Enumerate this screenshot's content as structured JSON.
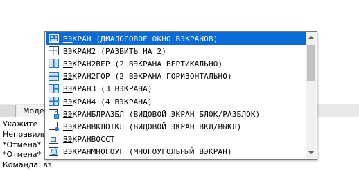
{
  "autocomplete": {
    "typed_prefix": "ВЭ",
    "items": [
      {
        "prefix": "ВЭ",
        "rest": "КРАН (ДИАЛОГОВОЕ ОКНО ВЭКРАНОВ)",
        "icon": "viewport-dialog-icon",
        "selected": true
      },
      {
        "prefix": "ВЭ",
        "rest": "КРАН2 (РАЗБИТЬ НА 2)",
        "icon": "viewports-2-icon",
        "selected": false
      },
      {
        "prefix": "ВЭ",
        "rest": "КРАН2ВЕР (2 ВЭКРАНА ВЕРТИКАЛЬНО)",
        "icon": "viewports-2-vertical-icon",
        "selected": false
      },
      {
        "prefix": "ВЭ",
        "rest": "КРАН2ГОР (2 ВЭКРАНА ГОРИЗОНТАЛЬНО)",
        "icon": "viewports-2-horizontal-icon",
        "selected": false
      },
      {
        "prefix": "ВЭ",
        "rest": "КРАН3 (3 ВЭКРАНА)",
        "icon": "viewports-3-icon",
        "selected": false
      },
      {
        "prefix": "ВЭ",
        "rest": "КРАН4 (4 ВЭКРАНА)",
        "icon": "viewports-4-icon",
        "selected": false
      },
      {
        "prefix": "ВЭ",
        "rest": "КРАНБЛРАЗБЛ (ВИДОВОЙ ЭКРАН БЛОК/РАЗБЛОК)",
        "icon": "viewport-lock-icon",
        "selected": false
      },
      {
        "prefix": "ВЭ",
        "rest": "КРАНВКЛОТКЛ (ВИДОВОЙ ЭКРАН ВКЛ/ВЫКЛ)",
        "icon": "viewport-onoff-icon",
        "selected": false
      },
      {
        "prefix": "ВЭ",
        "rest": "КРАНВОССТ",
        "icon": "viewport-restore-icon",
        "selected": false
      },
      {
        "prefix": "ВЭ",
        "rest": "КРАНМНОГОУГ (МНОГОУГОЛЬНЫЙ ВЭКРАН)",
        "icon": "viewport-polygonal-icon",
        "selected": false
      }
    ],
    "scroll_position_fraction": 0.1
  },
  "tabs": {
    "model_label": "Модел"
  },
  "command_history": [
    "Укажите",
    "Неправиль",
    "*Отмена*",
    "*Отмена*"
  ],
  "command_line": {
    "prompt": "Команда: вэ"
  },
  "colors": {
    "selection": "#0a6bd6",
    "icon_blue": "#1f78c8"
  }
}
